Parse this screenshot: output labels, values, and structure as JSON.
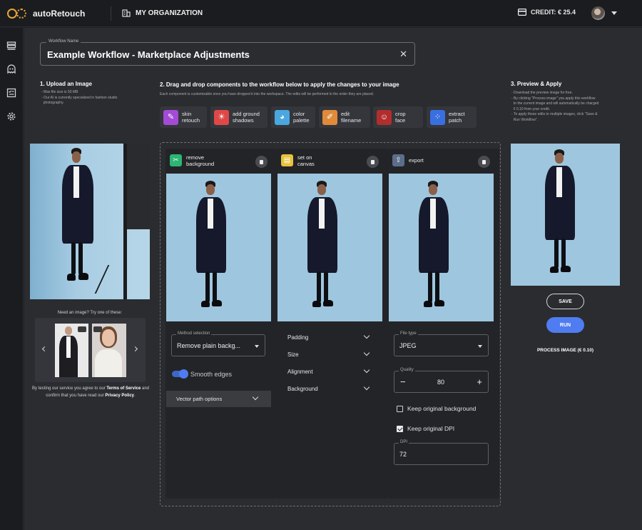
{
  "app": {
    "name": "autoRetouch",
    "organization": "MY ORGANIZATION",
    "credit": "CREDIT: € 25.4"
  },
  "sidebar": {
    "icons": [
      "stack-icon",
      "ghost-icon",
      "checklist-icon",
      "gear-icon"
    ]
  },
  "workflow": {
    "label": "Workflow Name",
    "value": "Example Workflow - Marketplace Adjustments"
  },
  "upload": {
    "title": "1. Upload an Image",
    "notes": [
      "- Max file size is 50 MB",
      "- Our AI is currently specialized in fashion studio",
      "  photography."
    ],
    "try_text": "Need an image? Try one of these:",
    "terms_pre": "By testing our service you agree to our ",
    "terms_link": "Terms of Service",
    "terms_mid": " and confirm that you have read our ",
    "privacy_link": "Privacy Policy",
    "terms_end": "."
  },
  "components": {
    "title": "2. Drag and drop components to the workflow below to apply the changes to your image",
    "subtitle": "Each component is customizable once you have dropped it into the workspace. The edits will be performed in the order they are placed.",
    "tools": [
      {
        "line1": "skin",
        "line2": "retouch",
        "color": "#a34bd6",
        "glyph": "✎"
      },
      {
        "line1": "add ground",
        "line2": "shadows",
        "color": "#e04848",
        "glyph": "☀"
      },
      {
        "line1": "color",
        "line2": "palette",
        "color": "#4aa7e0",
        "glyph": "◕"
      },
      {
        "line1": "edit",
        "line2": "filename",
        "color": "#e08a3a",
        "glyph": "✐"
      },
      {
        "line1": "crop",
        "line2": "face",
        "color": "#b32d2d",
        "glyph": "☺"
      },
      {
        "line1": "extract",
        "line2": "patch",
        "color": "#3a6fe0",
        "glyph": "⁘"
      }
    ]
  },
  "columns": {
    "remove": {
      "line1": "remove",
      "line2": "background",
      "color": "#2bb673",
      "method_label": "Method selection",
      "method_value": "Remove plain backg...",
      "smooth": "Smooth edges",
      "vector": "Vector path options"
    },
    "canvas": {
      "line1": "set on",
      "line2": "canvas",
      "color": "#e8c23a",
      "options": [
        "Padding",
        "Size",
        "Alignment",
        "Background"
      ]
    },
    "export": {
      "line1": "export",
      "color": "#5b6e8a",
      "filetype_label": "File type",
      "filetype_value": "JPEG",
      "quality_label": "Quality",
      "quality_value": "80",
      "keep_bg": "Keep original background",
      "keep_dpi": "Keep original DPI",
      "dpi_label": "DPI",
      "dpi_value": "72",
      "keep_bg_checked": false,
      "keep_dpi_checked": true
    }
  },
  "preview": {
    "title": "3. Preview & Apply",
    "notes": [
      "- Download the preview image for free.",
      "- By clicking \"Process image\" you apply this workflow",
      "  to the current image and will automatically be charged",
      "  € 0.10 from your credit.",
      "- To apply these edits to multiple images, click \"Save &",
      "  Run Workflow\"."
    ],
    "save": "SAVE",
    "run": "RUN",
    "process": "PROCESS IMAGE (€ 0.10)"
  },
  "colors": {
    "accent": "#4f7cf0",
    "orange": "#e8a53a",
    "bg": "#2a2c30"
  }
}
